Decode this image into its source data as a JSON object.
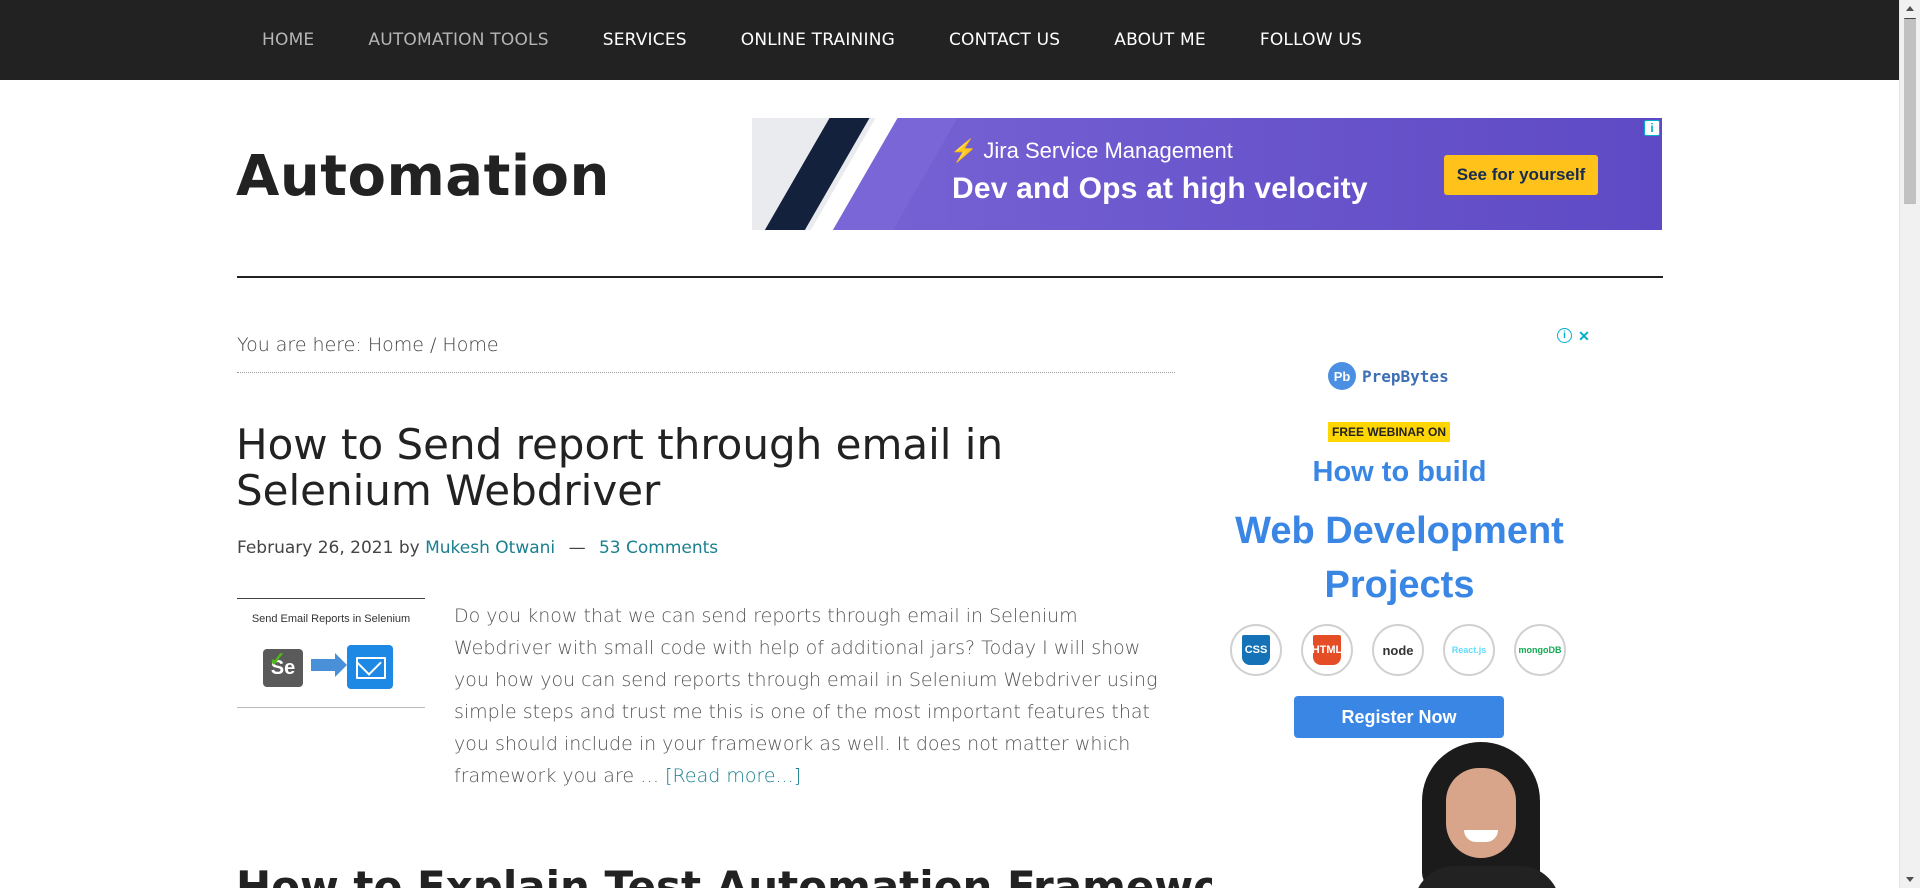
{
  "nav": {
    "items": [
      {
        "label": "HOME"
      },
      {
        "label": "AUTOMATION TOOLS"
      },
      {
        "label": "SERVICES"
      },
      {
        "label": "ONLINE TRAINING"
      },
      {
        "label": "CONTACT US"
      },
      {
        "label": "ABOUT ME"
      },
      {
        "label": "FOLLOW US"
      }
    ]
  },
  "header": {
    "site_title": "Automation"
  },
  "banner_ad": {
    "product": "Jira Service Management",
    "headline": "Dev and Ops at high velocity",
    "cta": "See for yourself"
  },
  "breadcrumb": {
    "prefix": "You are here: ",
    "home": "Home",
    "separator": " / ",
    "current": "Home"
  },
  "post": {
    "title": "How to Send report through email in Selenium Webdriver",
    "date": "February 26, 2021",
    "by": "by",
    "author": "Mukesh Otwani",
    "dash": "—",
    "comments": "53 Comments",
    "thumb_caption": "Send Email Reports in Selenium",
    "excerpt": "Do you know that we can send reports through email in Selenium Webdriver with small code with help of additional jars? Today I will show you how you can send reports through email in Selenium Webdriver using simple steps and trust me this is one of the most important features that you should include in your framework as well. It does not matter which framework you are … ",
    "read_more": "[Read more...]"
  },
  "next_post": {
    "title": "How to Explain Test Automation Framework"
  },
  "side_ad": {
    "brand": "PrepBytes",
    "tag": "FREE WEBINAR ON",
    "heading1": "How to build",
    "heading2": "Web Development Projects",
    "techs": [
      "CSS",
      "HTML",
      "node",
      "React.js",
      "mongoDB"
    ],
    "register": "Register Now"
  },
  "colors": {
    "nav_bg": "#222222",
    "link": "#1a7f8f",
    "ad_purple": "#6a55cc",
    "ad_cta": "#ffc21a",
    "prep_blue": "#3a86e5"
  }
}
